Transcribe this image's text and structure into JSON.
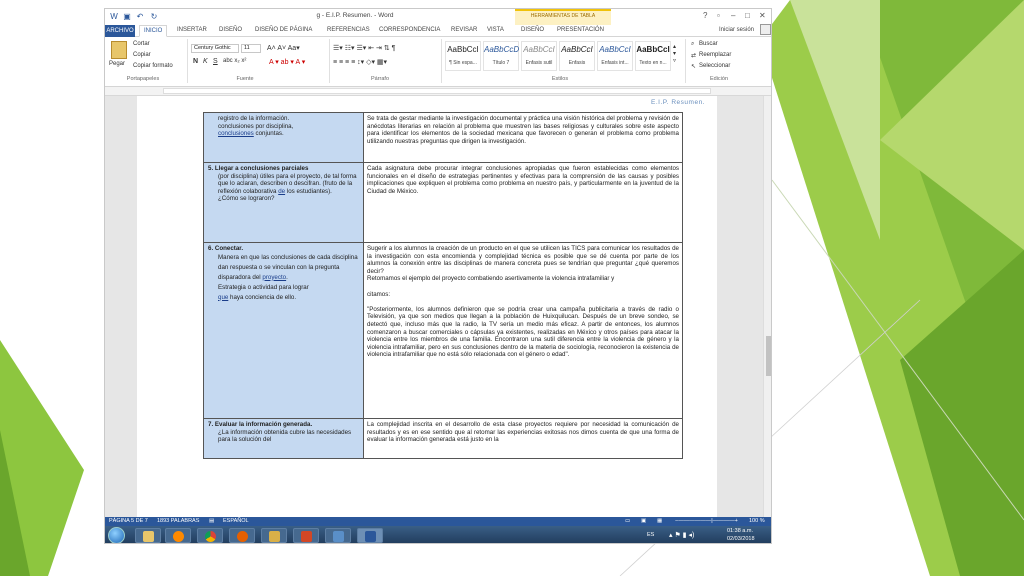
{
  "window": {
    "title": "g - E.I.P. Resumen. - Word",
    "contextual_tab": "HERRAMIENTAS DE TABLA",
    "signin": "Iniciar sesión"
  },
  "tabs": [
    "ARCHIVO",
    "INICIO",
    "INSERTAR",
    "DISEÑO",
    "DISEÑO DE PÁGINA",
    "REFERENCIAS",
    "CORRESPONDENCIA",
    "REVISAR",
    "VISTA",
    "DISEÑO",
    "PRESENTACIÓN"
  ],
  "ribbon": {
    "clipboard": {
      "paste": "Pegar",
      "cut": "Cortar",
      "copy": "Copiar",
      "format_painter": "Copiar formato",
      "group": "Portapapeles"
    },
    "font": {
      "family": "Century Gothic",
      "size": "11",
      "group": "Fuente"
    },
    "paragraph": {
      "group": "Párrafo"
    },
    "styles": {
      "items": [
        {
          "preview": "AaBbCcI",
          "name": "¶ Sin espa..."
        },
        {
          "preview": "AaBbCcD",
          "name": "Título 7"
        },
        {
          "preview": "AaBbCcI",
          "name": "Énfasis sutil"
        },
        {
          "preview": "AaBbCcI",
          "name": "Énfasis"
        },
        {
          "preview": "AaBbCcI",
          "name": "Énfasis int..."
        },
        {
          "preview": "AaBbCcI",
          "name": "Texto en n..."
        }
      ],
      "group": "Estilos"
    },
    "editing": {
      "find": "Buscar",
      "replace": "Reemplazar",
      "select": "Seleccionar",
      "group": "Edición"
    }
  },
  "document": {
    "header": "E.I.P. Resumen.",
    "rows": [
      {
        "left": "registro de la información.\nconclusiones por disciplina,",
        "left_u": "conclusiones",
        "left_tail": " conjuntas.",
        "right": "Se trata de gestar mediante la investigación documental y práctica una visión histórica del problema y revisión de anécdotas literarias en relación al problema que muestren las bases religiosas y culturales sobre este aspecto para identificar los elementos de la sociedad mexicana que favorecen o generan el problema como problema utilizando nuestras preguntas que dirigen la investigación."
      },
      {
        "title": "5. Llegar a conclusiones parciales",
        "left": "(por disciplina) útiles para el proyecto, de tal forma que lo aclaran, describen o descifran. (fruto de la reflexión colaborativa",
        "left_u": "de",
        "left_tail": " los estudiantes).\n¿Cómo se lograron?",
        "right": "Cada asignatura debe procurar integrar conclusiones apropiadas que fueron establecidas como elementos funcionales en el diseño de estrategias pertinentes y efectivas para la comprensión de las causas y posibles implicaciones que expliquen el problema como problema  en nuestro país, y particularmente en la juventud de la Ciudad de México."
      },
      {
        "title": "6. Conectar.",
        "left": "Manera en que las conclusiones de cada disciplina dan respuesta  o se vinculan con la pregunta  disparadora del",
        "left_u": "proyecto",
        "left_tail": ".\nEstrategia o  actividad para lograr",
        "left_u2": "que",
        "left_tail2": " haya   conciencia de ello.",
        "right": "Sugerir a los alumnos la creación de un producto en el que se utilicen las TICS para comunicar los resultados de la investigación con esta encomienda y complejidad técnica es posible que se dé cuenta por parte de los alumnos la conexión entre las disciplinas de manera concreta pues se tendrían que preguntar ¿qué queremos decir?\nRetomamos el ejemplo del proyecto combatiendo asertivamente la violencia intrafamiliar y\n\ncitamos:\n\n\"Posteriormente, los alumnos definieron que se podría crear una campaña publicitaria a través de radio o Televisión, ya que son medios que llegan a la población de Huixquilucan. Después de un breve sondeo, se detectó que, incluso más que la radio, la TV sería un medio más eficaz. A partir de entonces, los alumnos comenzaron a buscar comerciales o cápsulas ya existentes, realizadas en México y otros países para atacar la violencia entre los miembros de una familia. Encontraron una sutil diferencia entre la violencia de género y la violencia intrafamiliar, pero en sus conclusiones dentro de la materia de sociología, reconocieron la existencia de violencia intrafamiliar que no está sólo relacionada con el género o edad\"."
      },
      {
        "title": "7.  Evaluar la información generada.",
        "left": "¿La información obtenida cubre las necesidades para la solución del",
        "right": "La complejidad inscrita en el desarrollo de esta clase proyectos requiere por necesidad la comunicación de resultados y es en ese sentido que al retomar las experiencias exitosas nos dimos cuenta de que una forma de evaluar la información generada está justo en la"
      }
    ]
  },
  "statusbar": {
    "page": "PÁGINA 5 DE 7",
    "words": "1893 PALABRAS",
    "lang": "ESPAÑOL",
    "zoom": "100 %"
  },
  "taskbar": {
    "lang": "ES",
    "time": "01:38 a.m.",
    "date": "02/03/2018"
  },
  "colors": {
    "accent": "#2b579a",
    "table_left": "#c5d9f1",
    "green": "#8cc63e"
  }
}
